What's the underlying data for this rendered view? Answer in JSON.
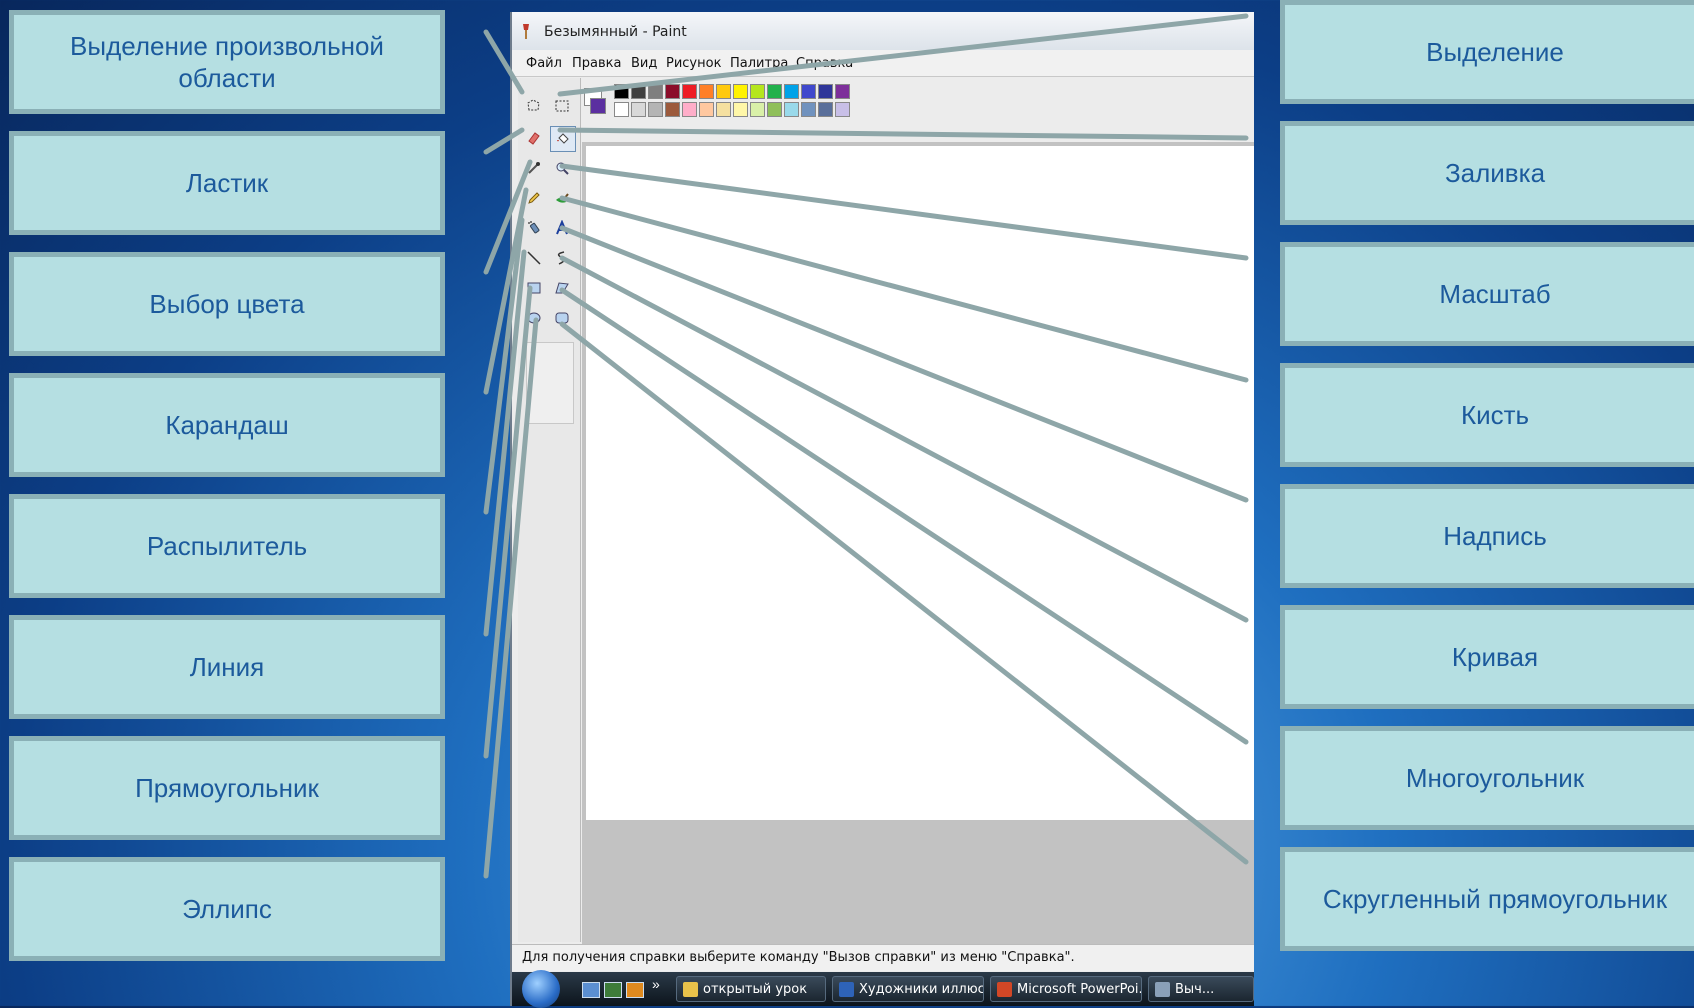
{
  "labels_left": [
    "Выделение произвольной области",
    "Ластик",
    "Выбор цвета",
    "Карандаш",
    "Распылитель",
    "Линия",
    "Прямоугольник",
    "Эллипс"
  ],
  "labels_right": [
    "Выделение",
    "Заливка",
    "Масштаб",
    "Кисть",
    "Надпись",
    "Кривая",
    "Многоугольник",
    "Скругленный прямоугольник"
  ],
  "paint": {
    "window_title": "Безымянный - Paint",
    "menu": [
      "Файл",
      "Правка",
      "Вид",
      "Рисунок",
      "Палитра",
      "Справка"
    ],
    "status_text": "Для получения справки выберите команду \"Вызов справки\" из меню \"Справка\".",
    "palette_row1": [
      "#000000",
      "#404040",
      "#7f7f7f",
      "#8b0d2a",
      "#ed1c24",
      "#ff7f27",
      "#ffc90e",
      "#fff200",
      "#b5e61d",
      "#22b14c",
      "#00a2e8",
      "#3f48cc",
      "#2f3699",
      "#7d2f9a"
    ],
    "palette_row2": [
      "#ffffff",
      "#d8d8d8",
      "#b4b4b4",
      "#9c5a3c",
      "#ffaec9",
      "#ffc8a0",
      "#f5e0a0",
      "#fff7a8",
      "#d9f0a8",
      "#8fbf5a",
      "#99d9ea",
      "#7092be",
      "#5a6f9a",
      "#c8bfe7"
    ]
  },
  "taskbar": {
    "items": [
      "открытый урок",
      "Художники иллюст...",
      "Microsoft PowerPoi...",
      "Выч..."
    ]
  },
  "colors": {
    "label_bg": "#b5dfe2",
    "label_text": "#1c5a9c",
    "connector": "#8ea6a8"
  }
}
